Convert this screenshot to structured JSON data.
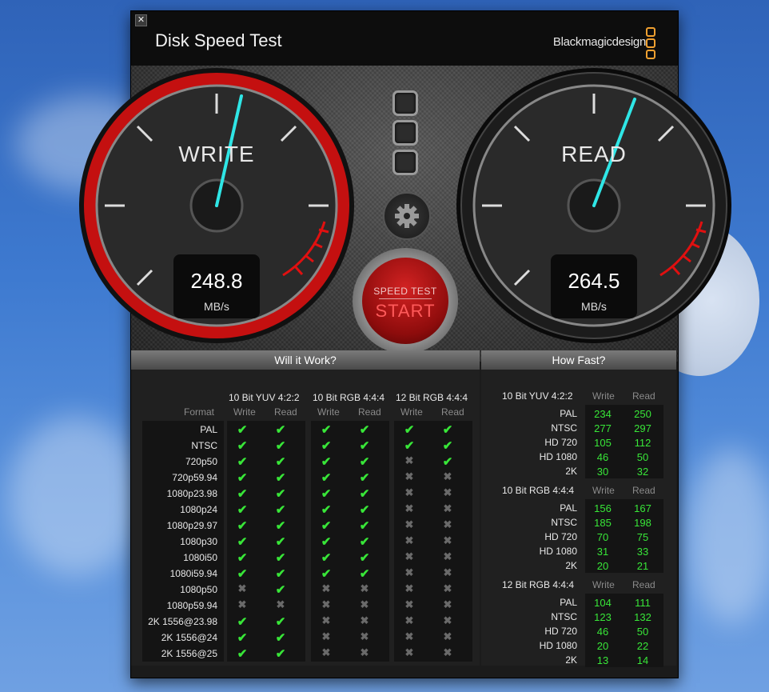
{
  "app": {
    "title": "Disk Speed Test",
    "brand": "Blackmagicdesign",
    "close_icon": "✕"
  },
  "write": {
    "label": "WRITE",
    "value": "248.8",
    "unit": "MB/s",
    "ring_color": "#c41010"
  },
  "read": {
    "label": "READ",
    "value": "264.5",
    "unit": "MB/s",
    "ring_color": "#1a1a1a"
  },
  "start_button": {
    "top": "SPEED TEST",
    "main": "START"
  },
  "will_it_work": {
    "title": "Will it Work?",
    "format_header": "Format",
    "groups": [
      {
        "name": "10 Bit YUV 4:2:2",
        "write": "Write",
        "read": "Read"
      },
      {
        "name": "10 Bit RGB 4:4:4",
        "write": "Write",
        "read": "Read"
      },
      {
        "name": "12 Bit RGB 4:4:4",
        "write": "Write",
        "read": "Read"
      }
    ],
    "rows": [
      {
        "format": "PAL",
        "marks": [
          1,
          1,
          1,
          1,
          1,
          1
        ]
      },
      {
        "format": "NTSC",
        "marks": [
          1,
          1,
          1,
          1,
          1,
          1
        ]
      },
      {
        "format": "720p50",
        "marks": [
          1,
          1,
          1,
          1,
          0,
          1
        ]
      },
      {
        "format": "720p59.94",
        "marks": [
          1,
          1,
          1,
          1,
          0,
          0
        ]
      },
      {
        "format": "1080p23.98",
        "marks": [
          1,
          1,
          1,
          1,
          0,
          0
        ]
      },
      {
        "format": "1080p24",
        "marks": [
          1,
          1,
          1,
          1,
          0,
          0
        ]
      },
      {
        "format": "1080p29.97",
        "marks": [
          1,
          1,
          1,
          1,
          0,
          0
        ]
      },
      {
        "format": "1080p30",
        "marks": [
          1,
          1,
          1,
          1,
          0,
          0
        ]
      },
      {
        "format": "1080i50",
        "marks": [
          1,
          1,
          1,
          1,
          0,
          0
        ]
      },
      {
        "format": "1080i59.94",
        "marks": [
          1,
          1,
          1,
          1,
          0,
          0
        ]
      },
      {
        "format": "1080p50",
        "marks": [
          0,
          1,
          0,
          0,
          0,
          0
        ]
      },
      {
        "format": "1080p59.94",
        "marks": [
          0,
          0,
          0,
          0,
          0,
          0
        ]
      },
      {
        "format": "2K 1556@23.98",
        "marks": [
          1,
          1,
          0,
          0,
          0,
          0
        ]
      },
      {
        "format": "2K 1556@24",
        "marks": [
          1,
          1,
          0,
          0,
          0,
          0
        ]
      },
      {
        "format": "2K 1556@25",
        "marks": [
          1,
          1,
          0,
          0,
          0,
          0
        ]
      }
    ]
  },
  "how_fast": {
    "title": "How Fast?",
    "groups": [
      {
        "name": "10 Bit YUV 4:2:2",
        "write": "Write",
        "read": "Read",
        "rows": [
          [
            "PAL",
            "234",
            "250"
          ],
          [
            "NTSC",
            "277",
            "297"
          ],
          [
            "HD 720",
            "105",
            "112"
          ],
          [
            "HD 1080",
            "46",
            "50"
          ],
          [
            "2K",
            "30",
            "32"
          ]
        ]
      },
      {
        "name": "10 Bit RGB 4:4:4",
        "write": "Write",
        "read": "Read",
        "rows": [
          [
            "PAL",
            "156",
            "167"
          ],
          [
            "NTSC",
            "185",
            "198"
          ],
          [
            "HD 720",
            "70",
            "75"
          ],
          [
            "HD 1080",
            "31",
            "33"
          ],
          [
            "2K",
            "20",
            "21"
          ]
        ]
      },
      {
        "name": "12 Bit RGB 4:4:4",
        "write": "Write",
        "read": "Read",
        "rows": [
          [
            "PAL",
            "104",
            "111"
          ],
          [
            "NTSC",
            "123",
            "132"
          ],
          [
            "HD 720",
            "46",
            "50"
          ],
          [
            "HD 1080",
            "20",
            "22"
          ],
          [
            "2K",
            "13",
            "14"
          ]
        ]
      }
    ]
  }
}
